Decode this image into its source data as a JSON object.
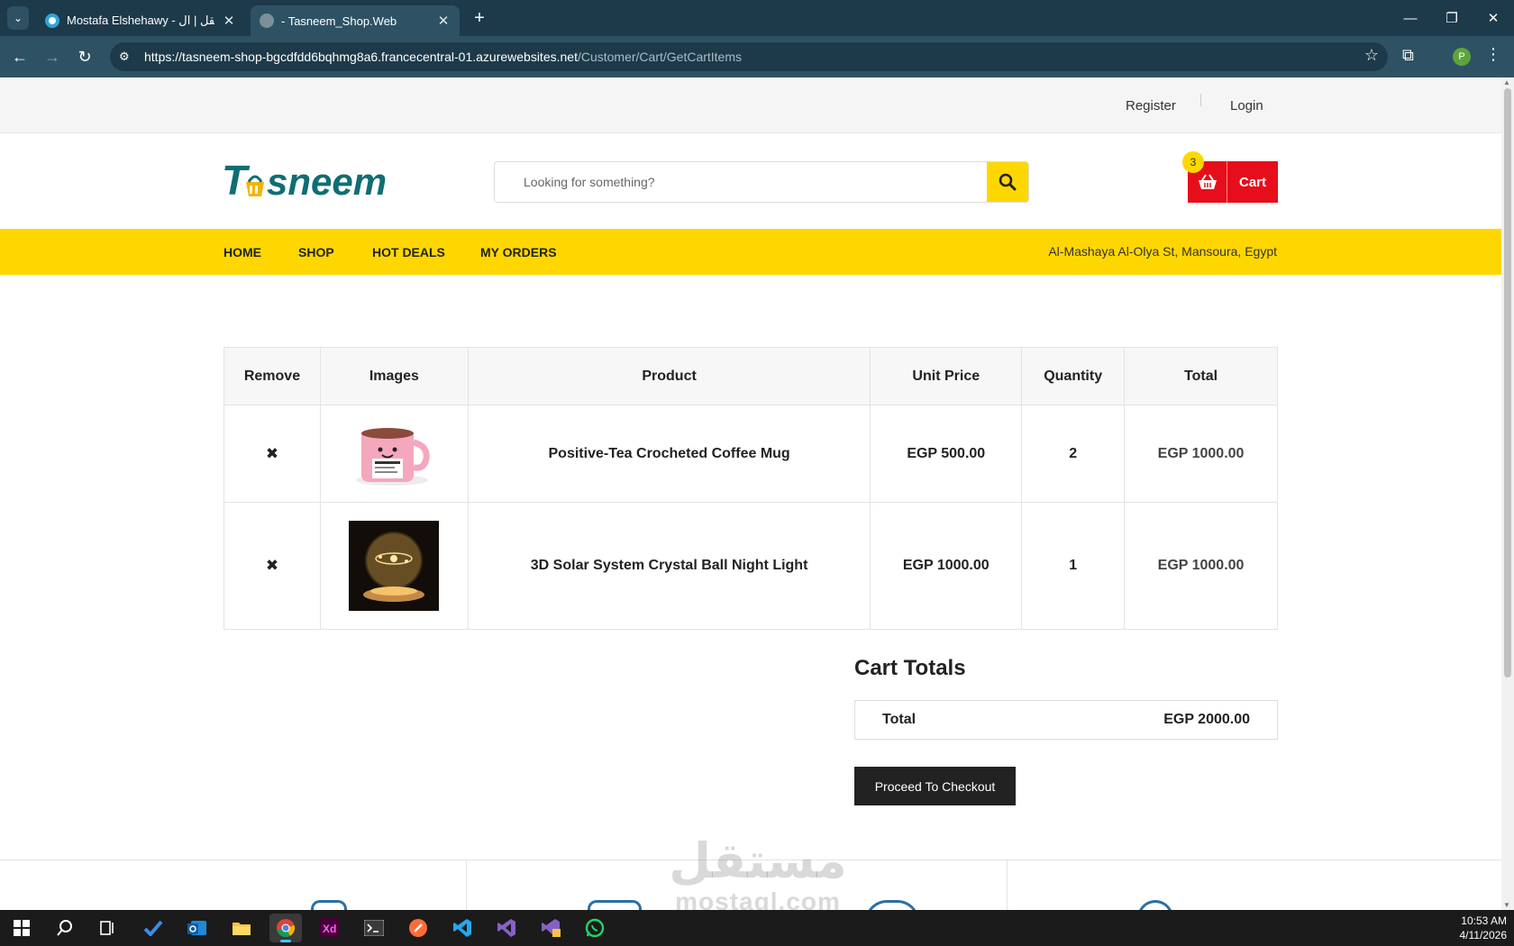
{
  "browser": {
    "tabs": [
      {
        "title": "Mostafa Elshehawy - مستقل | ال"
      },
      {
        "title": "- Tasneem_Shop.Web"
      }
    ],
    "url_host": "https://tasneem-shop-bgcdfdd6bqhmg8a6.francecentral-01.azurewebsites.net",
    "url_path": "/Customer/Cart/GetCartItems",
    "profile_initial": "P"
  },
  "topbar": {
    "register": "Register",
    "login": "Login"
  },
  "logo": {
    "text": "Tasneem"
  },
  "search": {
    "placeholder": "Looking for something?"
  },
  "cart": {
    "label": "Cart",
    "count": "3"
  },
  "nav": {
    "items": [
      "HOME",
      "SHOP",
      "HOT DEALS",
      "MY ORDERS"
    ],
    "address": "Al-Mashaya Al-Olya St, Mansoura, Egypt"
  },
  "table": {
    "headers": [
      "Remove",
      "Images",
      "Product",
      "Unit Price",
      "Quantity",
      "Total"
    ],
    "rows": [
      {
        "remove": "✖",
        "image": "pink-mug",
        "product": "Positive-Tea Crocheted Coffee Mug",
        "unit_price": "EGP 500.00",
        "quantity": "2",
        "total": "EGP 1000.00"
      },
      {
        "remove": "✖",
        "image": "crystal-ball-light",
        "product": "3D Solar System Crystal Ball Night Light",
        "unit_price": "EGP 1000.00",
        "quantity": "1",
        "total": "EGP 1000.00"
      }
    ]
  },
  "totals": {
    "title": "Cart Totals",
    "label": "Total",
    "value": "EGP 2000.00",
    "checkout": "Proceed To Checkout"
  },
  "watermark": {
    "arabic": "مستقل",
    "latin": "mostaql.com"
  },
  "taskbar": {
    "time": "10:53 AM",
    "date": "4/11/2026"
  },
  "colors": {
    "accent_yellow": "#ffd700",
    "cart_red": "#e60e1a",
    "logo_teal": "#0f6e73",
    "chrome_dark": "#1d3a4a"
  }
}
